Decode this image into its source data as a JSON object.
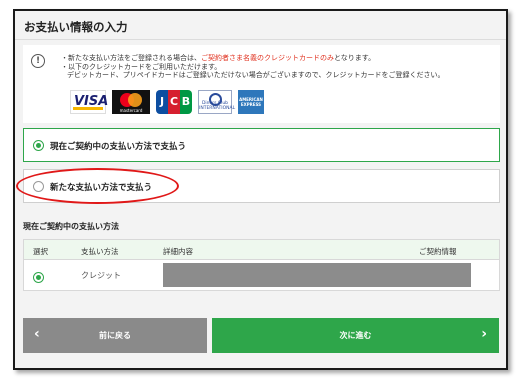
{
  "page": {
    "title": "お支払い情報の入力"
  },
  "notice": {
    "icon": "info-circle-icon",
    "line1_prefix": "・新たな支払い方法をご登録される場合は、",
    "line1_highlight": "ご契約者さま名義のクレジットカードのみ",
    "line1_suffix": "となります。",
    "line2": "・以下のクレジットカードをご利用いただけます。",
    "line3": "デビットカード、プリペイドカードはご登録いただけない場合がございますので、クレジットカードをご登録ください。",
    "highlight_color": "#e0301e"
  },
  "card_brands": {
    "visa": "VISA",
    "mastercard": "mastercard",
    "jcb": [
      "J",
      "C",
      "B"
    ],
    "diners": "Diners Club INTERNATIONAL",
    "amex": "AMERICAN EXPRESS"
  },
  "payment_options": [
    {
      "label": "現在ご契約中の支払い方法で支払う",
      "selected": true
    },
    {
      "label": "新たな支払い方法で支払う",
      "selected": false
    }
  ],
  "current_method": {
    "heading": "現在ご契約中の支払い方法",
    "columns": [
      "選択",
      "支払い方法",
      "詳細内容",
      "ご契約情報"
    ],
    "rows": [
      {
        "selected": true,
        "method": "クレジット",
        "details_masked": true
      }
    ]
  },
  "buttons": {
    "back": "前に戻る",
    "next": "次に進む",
    "back_icon": "chevron-left-icon",
    "next_icon": "chevron-right-icon"
  },
  "colors": {
    "accent_green": "#2ea64a",
    "annotation_red": "#e01818",
    "back_gray": "#8a8a8a"
  }
}
